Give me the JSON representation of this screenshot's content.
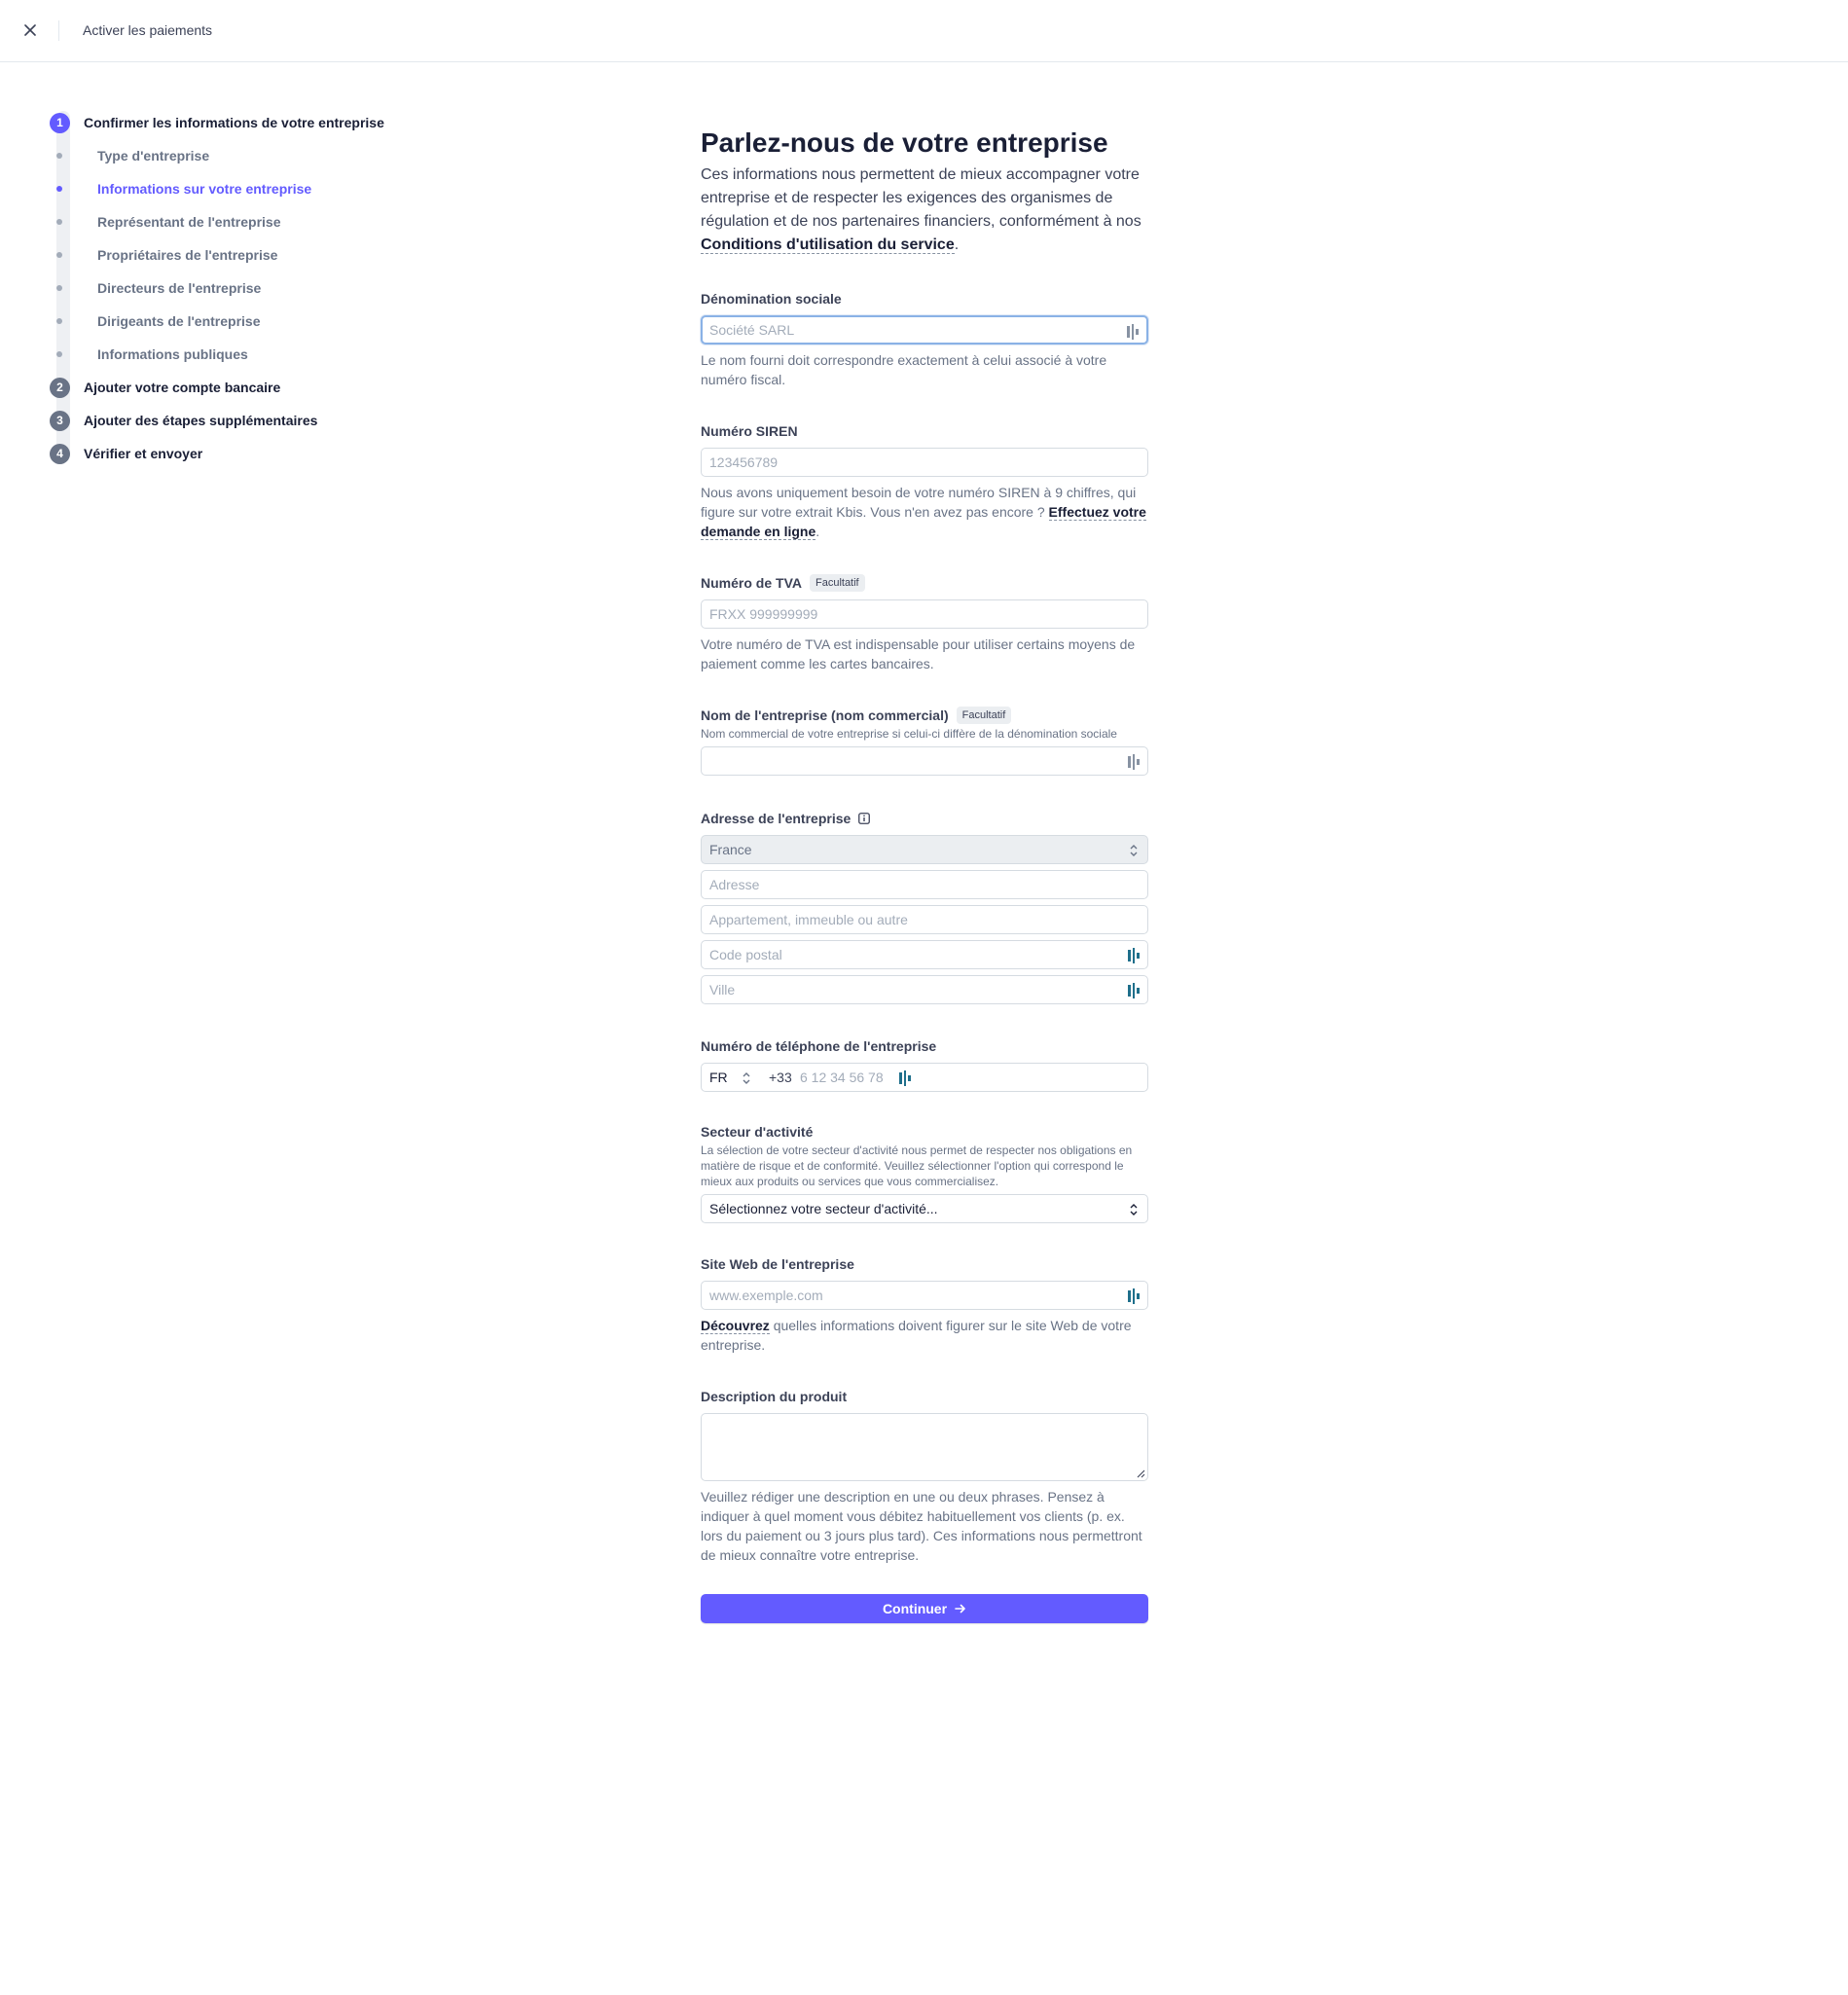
{
  "topbar": {
    "title": "Activer les paiements"
  },
  "steps": [
    {
      "num": "1",
      "label": "Confirmer les informations de votre entreprise",
      "active": true,
      "substeps": [
        {
          "label": "Type d'entreprise",
          "active": false
        },
        {
          "label": "Informations sur votre entreprise",
          "active": true
        },
        {
          "label": "Représentant de l'entreprise",
          "active": false
        },
        {
          "label": "Propriétaires de l'entreprise",
          "active": false
        },
        {
          "label": "Directeurs de l'entreprise",
          "active": false
        },
        {
          "label": "Dirigeants de l'entreprise",
          "active": false
        },
        {
          "label": "Informations publiques",
          "active": false
        }
      ]
    },
    {
      "num": "2",
      "label": "Ajouter votre compte bancaire",
      "active": false
    },
    {
      "num": "3",
      "label": "Ajouter des étapes supplémentaires",
      "active": false
    },
    {
      "num": "4",
      "label": "Vérifier et envoyer",
      "active": false
    }
  ],
  "main": {
    "title": "Parlez-nous de votre entreprise",
    "intro": "Ces informations nous permettent de mieux accompagner votre entreprise et de respecter les exigences des organismes de régulation et de nos partenaires financiers, conformément à nos ",
    "intro_link": "Conditions d'utilisation du service",
    "intro_end": "."
  },
  "fields": {
    "legal_name": {
      "label": "Dénomination sociale",
      "placeholder": "Société SARL",
      "help": "Le nom fourni doit correspondre exactement à celui associé à votre numéro fiscal."
    },
    "siren": {
      "label": "Numéro SIREN",
      "placeholder": "123456789",
      "help": "Nous avons uniquement besoin de votre numéro SIREN à 9 chiffres, qui figure sur votre extrait Kbis. Vous n'en avez pas encore ? ",
      "help_link": "Effectuez votre demande en ligne",
      "help_end": "."
    },
    "vat": {
      "label": "Numéro de TVA",
      "badge": "Facultatif",
      "placeholder": "FRXX 999999999",
      "help": "Votre numéro de TVA est indispensable pour utiliser certains moyens de paiement comme les cartes bancaires."
    },
    "trade_name": {
      "label": "Nom de l'entreprise (nom commercial)",
      "badge": "Facultatif",
      "sublabel": "Nom commercial de votre entreprise si celui-ci diffère de la dénomination sociale"
    },
    "address": {
      "label": "Adresse de l'entreprise",
      "country": "France",
      "line1": "Adresse",
      "line2": "Appartement, immeuble ou autre",
      "postal": "Code postal",
      "city": "Ville"
    },
    "phone": {
      "label": "Numéro de téléphone de l'entreprise",
      "country_code": "FR",
      "prefix": "+33",
      "placeholder": "6 12 34 56 78"
    },
    "industry": {
      "label": "Secteur d'activité",
      "sublabel": "La sélection de votre secteur d'activité nous permet de respecter nos obligations en matière de risque et de conformité. Veuillez sélectionner l'option qui correspond le mieux aux produits ou services que vous commercialisez.",
      "value": "Sélectionnez votre secteur d'activité..."
    },
    "website": {
      "label": "Site Web de l'entreprise",
      "placeholder": "www.exemple.com",
      "help_link": "Découvrez",
      "help": " quelles informations doivent figurer sur le site Web de votre entreprise."
    },
    "description": {
      "label": "Description du produit",
      "help": "Veuillez rédiger une description en une ou deux phrases. Pensez à indiquer à quel moment vous débitez habituellement vos clients (p. ex. lors du paiement ou 3 jours plus tard). Ces informations nous permettront de mieux connaître votre entreprise."
    }
  },
  "continue_label": "Continuer",
  "colors": {
    "accent": "#635bff",
    "text": "#1a1f36",
    "muted": "#697386"
  }
}
